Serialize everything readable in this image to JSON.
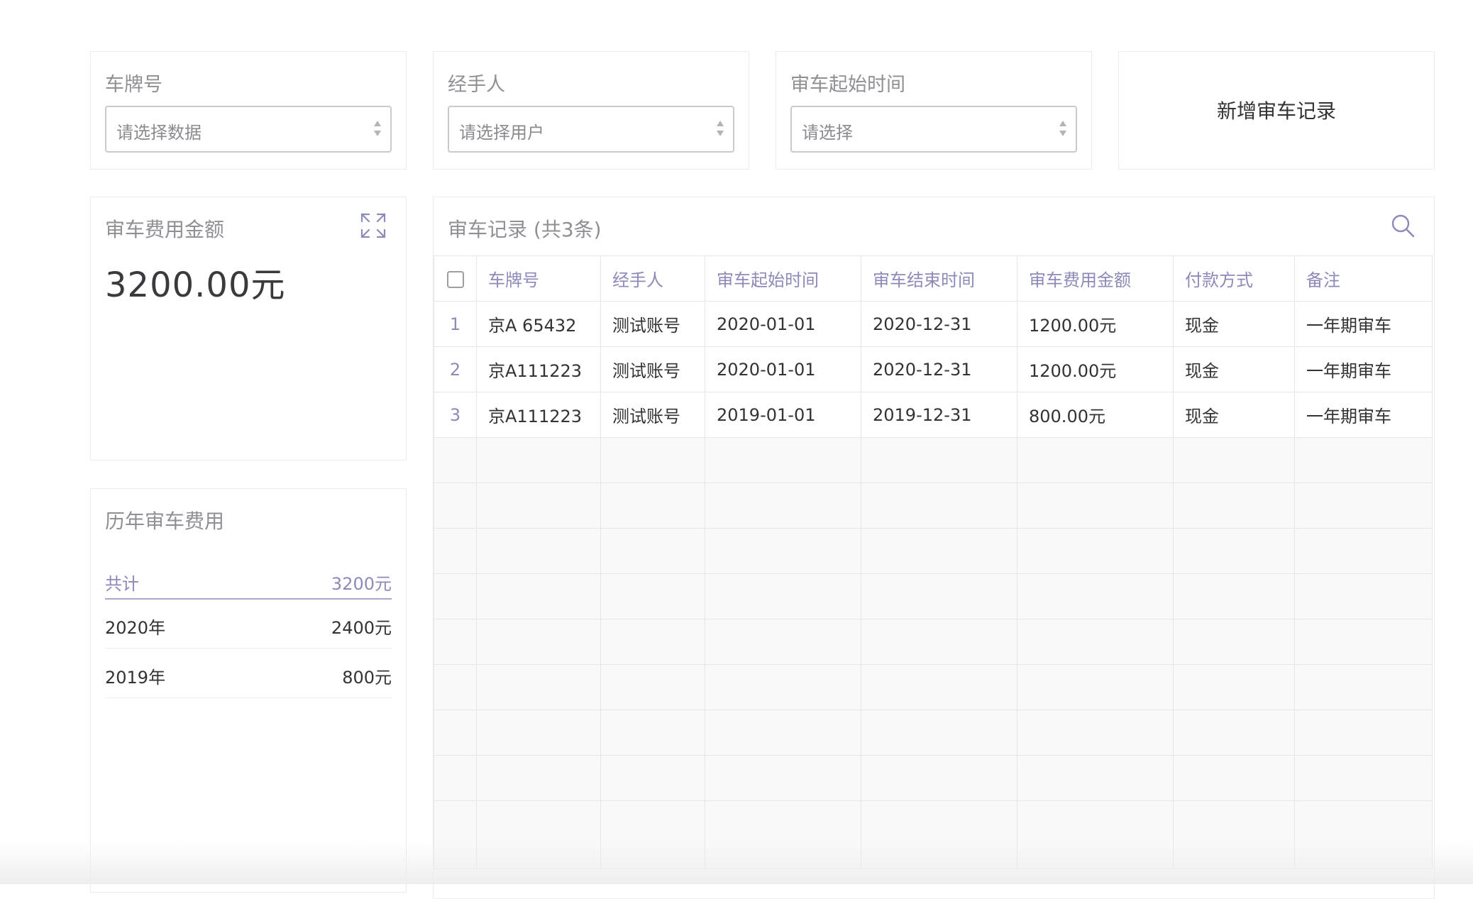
{
  "filters": {
    "plate": {
      "label": "车牌号",
      "placeholder": "请选择数据"
    },
    "handler": {
      "label": "经手人",
      "placeholder": "请选择用户"
    },
    "start_time": {
      "label": "审车起始时间",
      "placeholder": "请选择"
    }
  },
  "add_button": {
    "label": "新增审车记录"
  },
  "fee_card": {
    "title": "审车费用金额",
    "amount": "3200.00元"
  },
  "history": {
    "title": "历年审车费用",
    "total_label": "共计",
    "total_value": "3200元",
    "rows": [
      {
        "year": "2020年",
        "value": "2400元"
      },
      {
        "year": "2019年",
        "value": "800元"
      }
    ]
  },
  "records": {
    "title": "审车记录 (共3条)",
    "columns": [
      "车牌号",
      "经手人",
      "审车起始时间",
      "审车结束时间",
      "审车费用金额",
      "付款方式",
      "备注"
    ],
    "rows": [
      {
        "index": "1",
        "plate": "京A 65432",
        "handler": "测试账号",
        "start": "2020-01-01",
        "end": "2020-12-31",
        "amount": "1200.00元",
        "payment": "现金",
        "note": "一年期审车"
      },
      {
        "index": "2",
        "plate": "京A111223",
        "handler": "测试账号",
        "start": "2020-01-01",
        "end": "2020-12-31",
        "amount": "1200.00元",
        "payment": "现金",
        "note": "一年期审车"
      },
      {
        "index": "3",
        "plate": "京A111223",
        "handler": "测试账号",
        "start": "2019-01-01",
        "end": "2019-12-31",
        "amount": "800.00元",
        "payment": "现金",
        "note": "一年期审车"
      }
    ]
  },
  "colors": {
    "accent": "#8c8ab8",
    "border": "#ececef",
    "muted_text": "#8f8f95"
  },
  "icons": {
    "expand": "expand-icon",
    "search": "search-icon"
  }
}
